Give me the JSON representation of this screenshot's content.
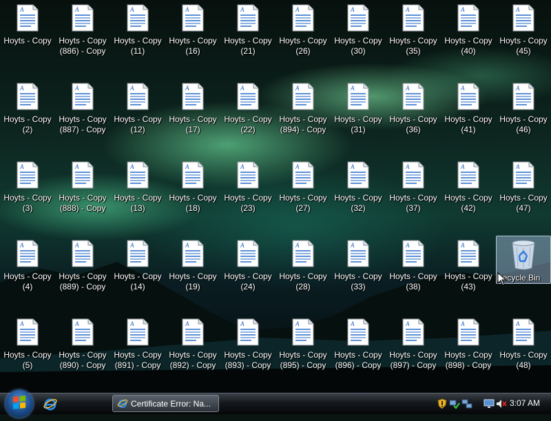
{
  "desktop": {
    "icons": [
      {
        "label": "Hoyts - Copy",
        "icon": "document-icon"
      },
      {
        "label": "Hoyts - Copy\n(886) - Copy",
        "icon": "document-icon"
      },
      {
        "label": "Hoyts - Copy\n(11)",
        "icon": "document-icon"
      },
      {
        "label": "Hoyts - Copy\n(16)",
        "icon": "document-icon"
      },
      {
        "label": "Hoyts - Copy\n(21)",
        "icon": "document-icon"
      },
      {
        "label": "Hoyts - Copy\n(26)",
        "icon": "document-icon"
      },
      {
        "label": "Hoyts - Copy\n(30)",
        "icon": "document-icon"
      },
      {
        "label": "Hoyts - Copy\n(35)",
        "icon": "document-icon"
      },
      {
        "label": "Hoyts - Copy\n(40)",
        "icon": "document-icon"
      },
      {
        "label": "Hoyts - Copy\n(45)",
        "icon": "document-icon"
      },
      {
        "label": "Hoyts - Copy\n(2)",
        "icon": "document-icon"
      },
      {
        "label": "Hoyts - Copy\n(887) - Copy",
        "icon": "document-icon"
      },
      {
        "label": "Hoyts - Copy\n(12)",
        "icon": "document-icon"
      },
      {
        "label": "Hoyts - Copy\n(17)",
        "icon": "document-icon"
      },
      {
        "label": "Hoyts - Copy\n(22)",
        "icon": "document-icon"
      },
      {
        "label": "Hoyts - Copy\n(894) - Copy",
        "icon": "document-icon"
      },
      {
        "label": "Hoyts - Copy\n(31)",
        "icon": "document-icon"
      },
      {
        "label": "Hoyts - Copy\n(36)",
        "icon": "document-icon"
      },
      {
        "label": "Hoyts - Copy\n(41)",
        "icon": "document-icon"
      },
      {
        "label": "Hoyts - Copy\n(46)",
        "icon": "document-icon"
      },
      {
        "label": "Hoyts - Copy\n(3)",
        "icon": "document-icon"
      },
      {
        "label": "Hoyts - Copy\n(888) - Copy",
        "icon": "document-icon"
      },
      {
        "label": "Hoyts - Copy\n(13)",
        "icon": "document-icon"
      },
      {
        "label": "Hoyts - Copy\n(18)",
        "icon": "document-icon"
      },
      {
        "label": "Hoyts - Copy\n(23)",
        "icon": "document-icon"
      },
      {
        "label": "Hoyts - Copy\n(27)",
        "icon": "document-icon"
      },
      {
        "label": "Hoyts - Copy\n(32)",
        "icon": "document-icon"
      },
      {
        "label": "Hoyts - Copy\n(37)",
        "icon": "document-icon"
      },
      {
        "label": "Hoyts - Copy\n(42)",
        "icon": "document-icon"
      },
      {
        "label": "Hoyts - Copy\n(47)",
        "icon": "document-icon"
      },
      {
        "label": "Hoyts - Copy\n(4)",
        "icon": "document-icon"
      },
      {
        "label": "Hoyts - Copy\n(889) - Copy",
        "icon": "document-icon"
      },
      {
        "label": "Hoyts - Copy\n(14)",
        "icon": "document-icon"
      },
      {
        "label": "Hoyts - Copy\n(19)",
        "icon": "document-icon"
      },
      {
        "label": "Hoyts - Copy\n(24)",
        "icon": "document-icon"
      },
      {
        "label": "Hoyts - Copy\n(28)",
        "icon": "document-icon"
      },
      {
        "label": "Hoyts - Copy\n(33)",
        "icon": "document-icon"
      },
      {
        "label": "Hoyts - Copy\n(38)",
        "icon": "document-icon"
      },
      {
        "label": "Hoyts - Copy\n(43)",
        "icon": "document-icon"
      },
      {
        "label": "Hoyts - Copy\n(5)",
        "icon": "document-icon"
      },
      {
        "label": "Hoyts - Copy\n(890) - Copy",
        "icon": "document-icon"
      },
      {
        "label": "Hoyts - Copy\n(891) - Copy",
        "icon": "document-icon"
      },
      {
        "label": "Hoyts - Copy\n(892) - Copy",
        "icon": "document-icon"
      },
      {
        "label": "Hoyts - Copy\n(893) - Copy",
        "icon": "document-icon"
      },
      {
        "label": "Hoyts - Copy\n(895) - Copy",
        "icon": "document-icon"
      },
      {
        "label": "Hoyts - Copy\n(896) - Copy",
        "icon": "document-icon"
      },
      {
        "label": "Hoyts - Copy\n(897) - Copy",
        "icon": "document-icon"
      },
      {
        "label": "Hoyts - Copy\n(898) - Copy",
        "icon": "document-icon"
      },
      {
        "label": "Hoyts - Copy\n(48)",
        "icon": "document-icon"
      }
    ],
    "recycle_bin": {
      "label": "Recycle Bin",
      "icon": "recycle-bin-icon"
    }
  },
  "taskbar": {
    "start_icon": "windows-start-icon",
    "quick_launch": [
      {
        "icon": "internet-explorer-icon"
      }
    ],
    "task_buttons": [
      {
        "label": "Certificate Error: Na...",
        "icon": "internet-explorer-icon"
      }
    ],
    "tray_icons": [
      "shield-warning-icon",
      "network-check-icon",
      "network-icon",
      "display-icon",
      "volume-muted-icon"
    ],
    "clock": "3:07 AM"
  },
  "colors": {
    "aurora": "#7cf0aa",
    "taskbar": "#15191d",
    "selection": "#aac8e6"
  }
}
